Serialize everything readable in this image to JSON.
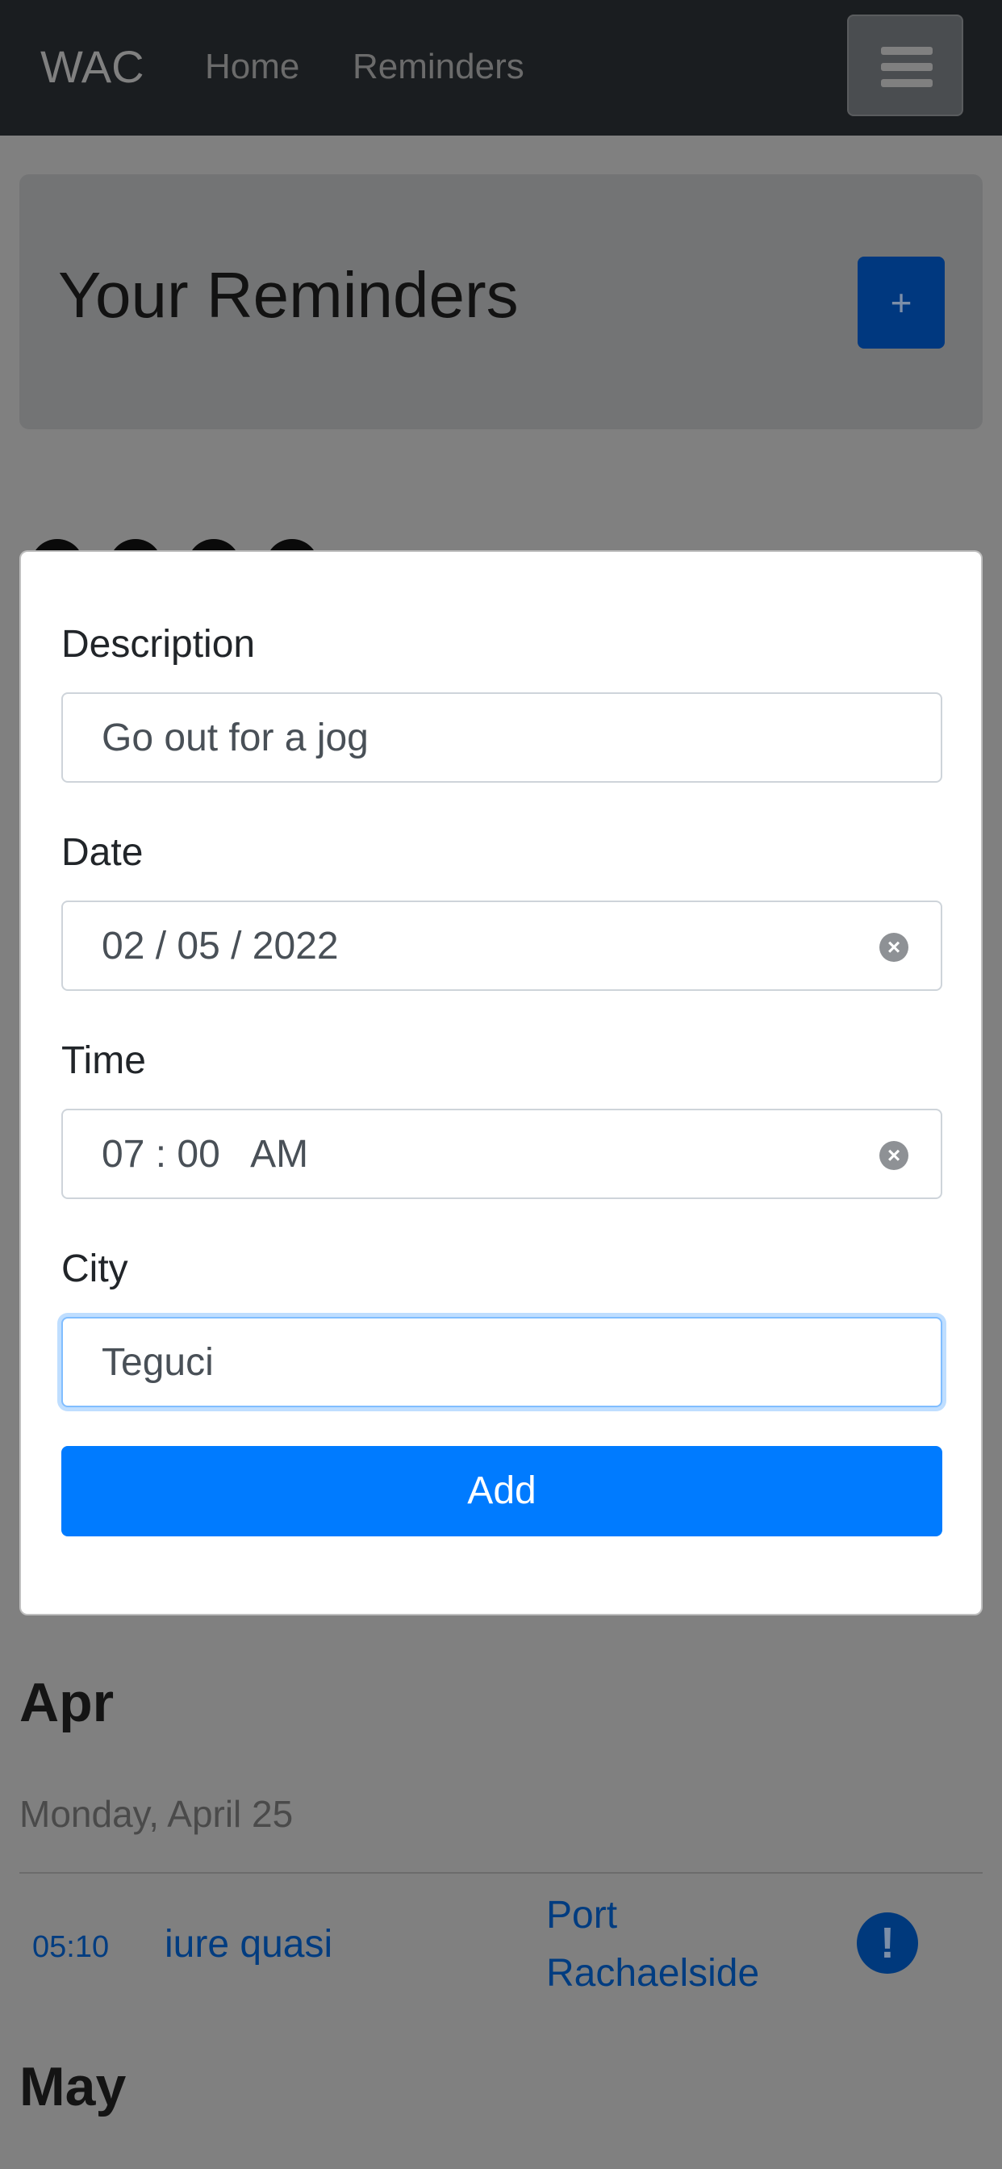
{
  "navbar": {
    "brand": "WAC",
    "links": [
      "Home",
      "Reminders"
    ],
    "toggler_icon": "hamburger-menu-icon"
  },
  "header": {
    "title": "Your Reminders",
    "add_label": "+"
  },
  "modal": {
    "description": {
      "label": "Description",
      "value": "Go out for a jog"
    },
    "date": {
      "label": "Date",
      "value": "02 / 05 / 2022"
    },
    "time": {
      "label": "Time",
      "value": "07 : 00   AM"
    },
    "city": {
      "label": "City",
      "value": "Teguci"
    },
    "submit_label": "Add"
  },
  "reminders": {
    "months": [
      {
        "name": "Apr",
        "days": [
          {
            "heading": "Monday, April 25",
            "items": [
              {
                "time": "05:10",
                "description": "iure quasi",
                "city": "Port Rachaelside",
                "status_icon": "exclamation-circle-icon"
              }
            ]
          }
        ]
      },
      {
        "name": "May"
      }
    ]
  },
  "colors": {
    "navbar_bg": "#343a40",
    "primary": "#007bff",
    "overlay": "rgba(0,0,0,0.5)"
  }
}
